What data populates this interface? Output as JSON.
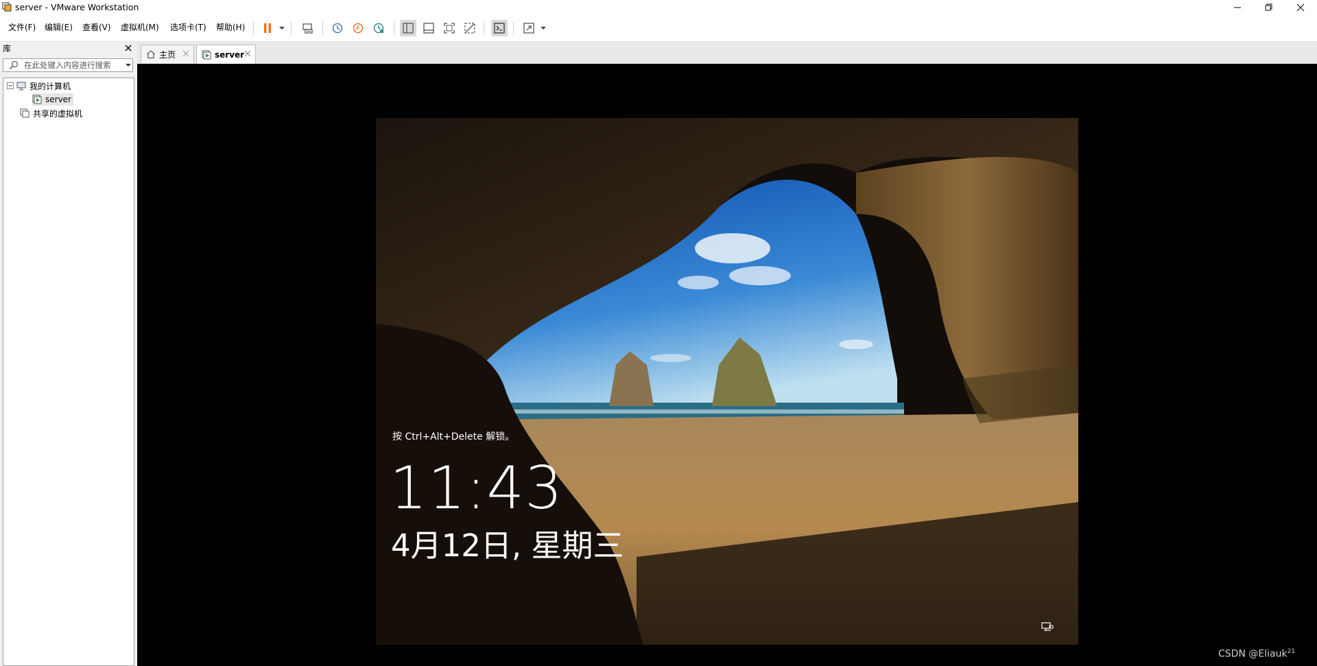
{
  "window": {
    "title": "server - VMware Workstation"
  },
  "menu": [
    "文件(F)",
    "编辑(E)",
    "查看(V)",
    "虚拟机(M)",
    "选项卡(T)",
    "帮助(H)"
  ],
  "toolbar": {
    "icons": [
      "pause-icon",
      "send-keys-icon",
      "snapshot-icon",
      "revert-snapshot-icon",
      "snapshot-manager-icon",
      "library-view-icon",
      "thumbnail-bar-icon",
      "full-screen-icon",
      "unity-icon",
      "console-view-icon",
      "stretch-guest-icon"
    ],
    "accent_color": "#e8731d"
  },
  "library": {
    "title": "库",
    "search_placeholder": "在此处键入内容进行搜索",
    "tree": [
      {
        "label": "我的计算机",
        "icon": "computer-icon",
        "expanded": true
      },
      {
        "label": "server",
        "icon": "vm-running-icon",
        "selected": true
      },
      {
        "label": "共享的虚拟机",
        "icon": "shared-vms-icon"
      }
    ]
  },
  "tabs": [
    {
      "label": "主页",
      "icon": "home-icon",
      "active": false
    },
    {
      "label": "server",
      "icon": "vm-running-icon",
      "active": true
    }
  ],
  "vm": {
    "lock_hint": "按 Ctrl+Alt+Delete 解锁。",
    "time": "11:43",
    "date": "4月12日, 星期三",
    "network_icon": "network-icon"
  },
  "watermark": {
    "text": "CSDN @Eliauk",
    "sup": "21"
  }
}
